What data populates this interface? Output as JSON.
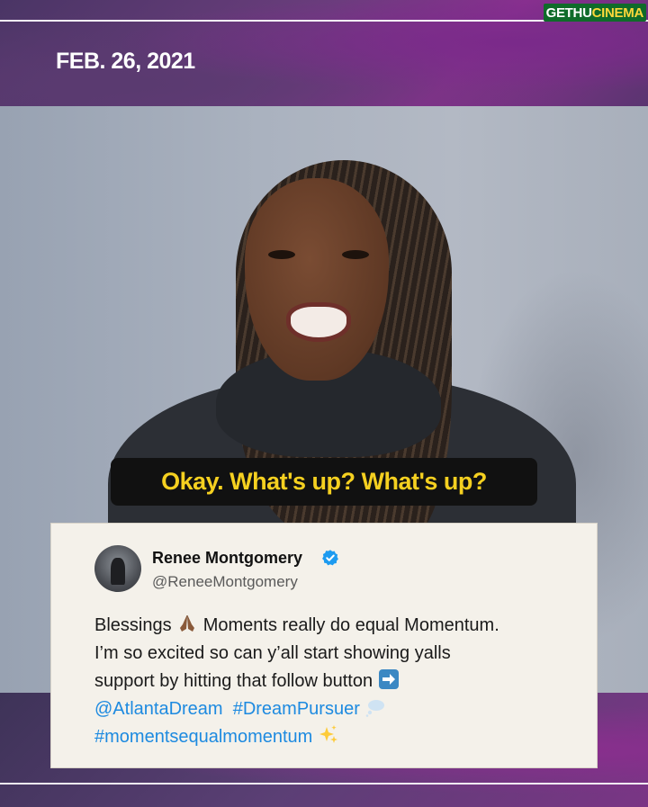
{
  "watermark": {
    "part1": "GETHU",
    "part2": "CINEMA"
  },
  "date": "FEB. 26, 2021",
  "caption": "Okay. What's up? What's up?",
  "tweet": {
    "name": "Renee Montgomery",
    "handle": "@ReneeMontgomery",
    "line1_a": "Blessings",
    "line1_b": "Moments really do equal Momentum.",
    "line2": "I’m so excited so can y’all start showing yalls",
    "line3": "support by hitting that follow button",
    "mention": "@AtlantaDream",
    "hashtag1": "#DreamPursuer",
    "hashtag2": "#momentsequalmomentum"
  },
  "colors": {
    "caption_text": "#f5d020",
    "link": "#1d8ae0",
    "verified": "#1d9bf0"
  },
  "icons": [
    "praying-hands-emoji",
    "right-arrow-emoji",
    "thought-balloon-emoji",
    "sparkles-emoji",
    "verified-badge-icon"
  ]
}
